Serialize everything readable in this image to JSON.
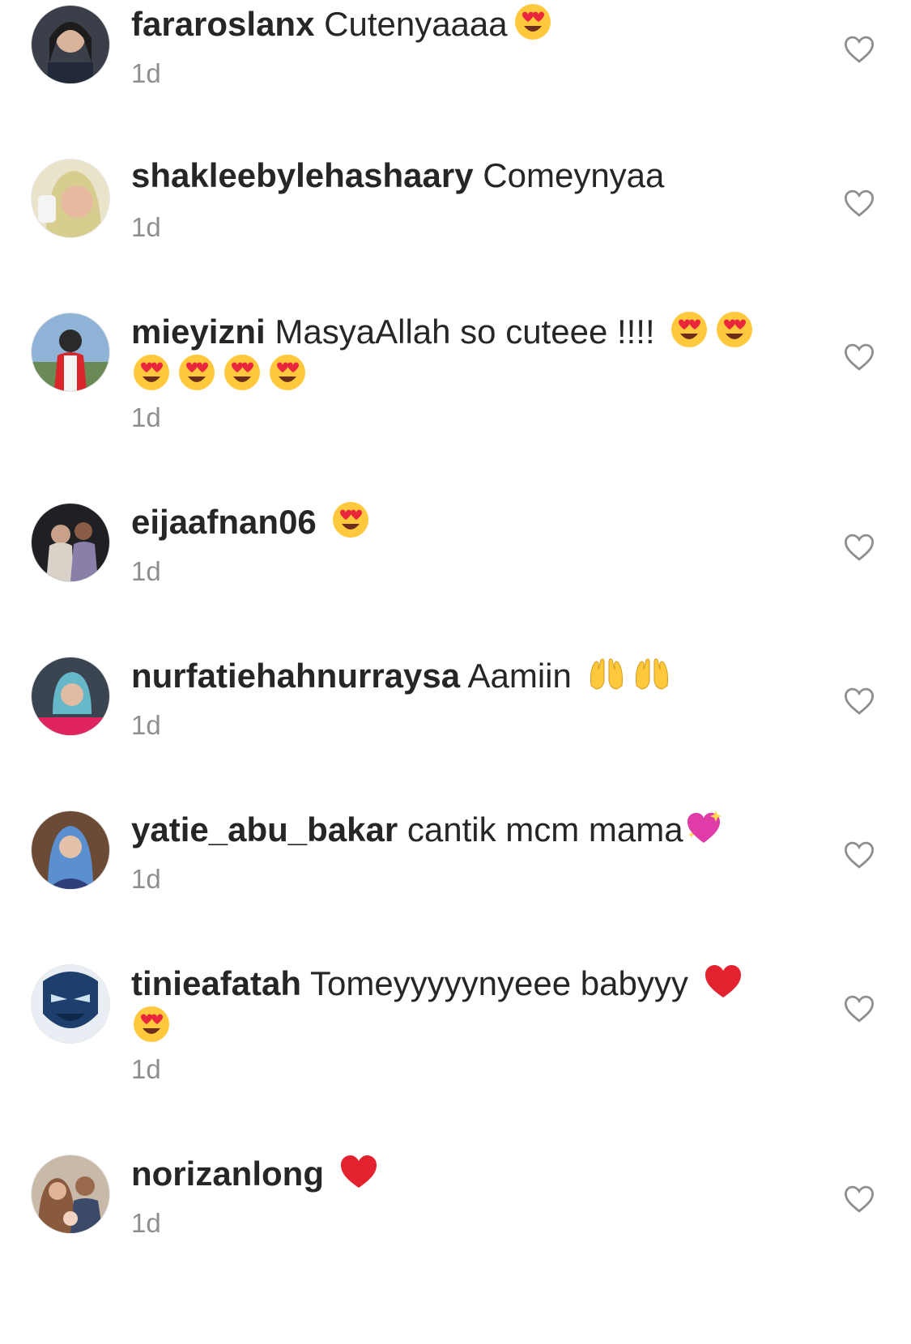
{
  "comments": [
    {
      "username": "fararoslanx",
      "text": "Cutenyaaaa",
      "emojis": [
        "heart-eyes"
      ],
      "time": "1d"
    },
    {
      "username": "shakleebylehashaary",
      "text": "Comeynyaa",
      "emojis": [],
      "time": "1d"
    },
    {
      "username": "mieyizni",
      "text": "MasyaAllah so cuteee !!!!",
      "emojis": [
        "heart-eyes",
        "heart-eyes",
        "heart-eyes",
        "heart-eyes",
        "heart-eyes",
        "heart-eyes"
      ],
      "time": "1d"
    },
    {
      "username": "eijaafnan06",
      "text": "",
      "emojis": [
        "heart-eyes"
      ],
      "time": "1d"
    },
    {
      "username": "nurfatiehahnurraysa",
      "text": "Aamiin",
      "emojis": [
        "raised-hands",
        "raised-hands"
      ],
      "time": "1d"
    },
    {
      "username": "yatie_abu_bakar",
      "text": "cantik mcm mama",
      "emojis": [
        "sparkling-heart"
      ],
      "time": "1d"
    },
    {
      "username": "tinieafatah",
      "text": "Tomeyyyyynyeee babyyy",
      "emojis": [
        "red-heart",
        "heart-eyes"
      ],
      "time": "1d"
    },
    {
      "username": "norizanlong",
      "text": "",
      "emojis": [
        "red-heart"
      ],
      "time": "1d"
    }
  ],
  "colors": {
    "text": "#262626",
    "muted": "#8e8e8e",
    "background": "#ffffff"
  }
}
